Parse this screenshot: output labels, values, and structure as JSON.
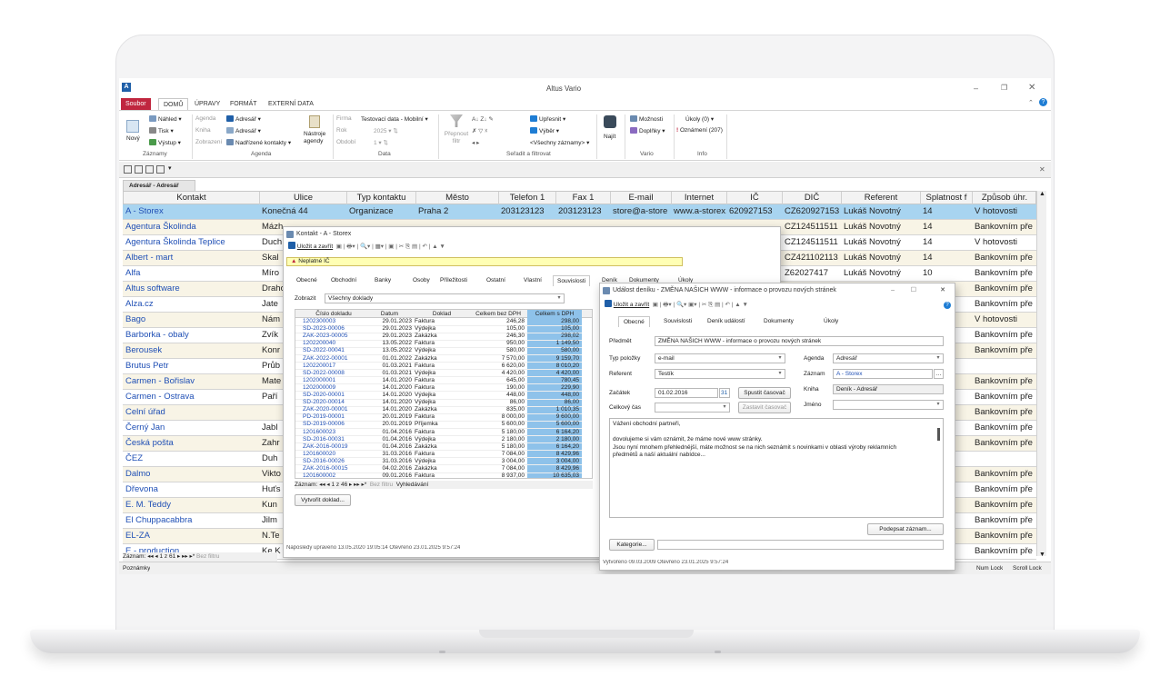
{
  "app": {
    "logo_letter": "A",
    "title": "Altus Vario",
    "colors": {
      "accent": "#c0263f",
      "selection": "#a8d4f0",
      "link": "#1f4fb5",
      "odd_row": "#f8f4e6",
      "sum_column": "#74b4e4"
    }
  },
  "ribbon_tabs": [
    "Soubor",
    "DOMŮ",
    "ÚPRAVY",
    "FORMÁT",
    "EXTERNÍ DATA"
  ],
  "ribbon": {
    "zaznamy": {
      "novy": "Nový",
      "nahled": "Náhled",
      "tisk": "Tisk",
      "vystup": "Výstup",
      "label": "Záznamy"
    },
    "agenda": {
      "agenda": "Agenda",
      "kniha": "Kniha",
      "zobrazeni": "Zobrazení",
      "adresar1": "Adresář",
      "adresar2": "Adresář",
      "nadrizene": "Nadřízené kontakty",
      "nastroje": "Nástroje agendy",
      "label": "Agenda"
    },
    "data": {
      "firma_label": "Firma",
      "firma_value": "Testovací data - Mobilní",
      "rok_label": "Rok",
      "rok_value": "2025",
      "obdobi_label": "Období",
      "obdobi_value": "1",
      "label": "Data"
    },
    "filtr": {
      "prepnout": "Přepnout filtr",
      "upresnit": "Upřesnit",
      "vyber": "Výběr",
      "vsechny": "<Všechny záznamy>",
      "label": "Seřadit a filtrovat"
    },
    "najit": {
      "label": "Najít"
    },
    "vario": {
      "moznosti": "Možnosti",
      "doplnky": "Doplňky",
      "label": "Vario"
    },
    "info": {
      "ukoly": "Úkoly (0)",
      "oznameni": "Oznámení (207)",
      "label": "Info"
    }
  },
  "document_tab": "Adresář - Adresář",
  "columns": [
    "Kontakt",
    "Ulice",
    "Typ kontaktu",
    "Město",
    "Telefon 1",
    "Fax 1",
    "E-mail",
    "Internet",
    "IČ",
    "DIČ",
    "Referent",
    "Splatnost f",
    "Způsob úhr."
  ],
  "rows": [
    [
      "A - Storex",
      "Konečná 44",
      "Organizace",
      "Praha 2",
      "203123123",
      "203123123",
      "store@a-store",
      "www.a-storex.",
      "620927153",
      "CZ620927153",
      "Lukáš Novotný",
      "14",
      "V hotovosti"
    ],
    [
      "Agentura Školinda",
      "Mázh",
      "",
      "",
      "",
      "",
      "",
      "",
      "",
      "CZ124511511",
      "Lukáš Novotný",
      "14",
      "Bankovním pře"
    ],
    [
      "Agentura Školinda Teplice",
      "Duch",
      "",
      "",
      "",
      "",
      "",
      "",
      "",
      "CZ124511511",
      "Lukáš Novotný",
      "14",
      "V hotovosti"
    ],
    [
      "Albert - mart",
      "Skal",
      "",
      "",
      "",
      "",
      "",
      "",
      "",
      "CZ421102113",
      "Lukáš Novotný",
      "14",
      "Bankovním pře"
    ],
    [
      "Alfa",
      "Míro",
      "",
      "",
      "",
      "",
      "",
      "",
      "",
      "Z62027417",
      "Lukáš Novotný",
      "10",
      "Bankovním pře"
    ],
    [
      "Altus software",
      "Draho",
      "",
      "",
      "",
      "",
      "",
      "",
      "",
      "",
      "",
      "",
      "Bankovním pře"
    ],
    [
      "Alza.cz",
      "Jate",
      "",
      "",
      "",
      "",
      "",
      "",
      "",
      "",
      "",
      "",
      "Bankovním pře"
    ],
    [
      "Bago",
      "Nám",
      "",
      "",
      "",
      "",
      "",
      "",
      "",
      "",
      "",
      "",
      "V hotovosti"
    ],
    [
      "Barborka - obaly",
      "Zvík",
      "",
      "",
      "",
      "",
      "",
      "",
      "",
      "",
      "",
      "",
      "Bankovním pře"
    ],
    [
      "Berousek",
      "Konr",
      "",
      "",
      "",
      "",
      "",
      "",
      "",
      "",
      "",
      "",
      "Bankovním pře"
    ],
    [
      "Brutus Petr",
      "Průb",
      "",
      "",
      "",
      "",
      "",
      "",
      "",
      "",
      "",
      "",
      ""
    ],
    [
      "Carmen - Bořislav",
      "Mate",
      "",
      "",
      "",
      "",
      "",
      "",
      "",
      "",
      "",
      "",
      "Bankovním pře"
    ],
    [
      "Carmen - Ostrava",
      "Paří",
      "",
      "",
      "",
      "",
      "",
      "",
      "",
      "",
      "",
      "",
      "Bankovním pře"
    ],
    [
      "Celní úřad",
      "",
      "",
      "",
      "",
      "",
      "",
      "",
      "",
      "",
      "",
      "",
      "Bankovním pře"
    ],
    [
      "Černý Jan",
      "Jabl",
      "",
      "",
      "",
      "",
      "",
      "",
      "",
      "",
      "",
      "",
      "Bankovním pře"
    ],
    [
      "Česká pošta",
      "Zahr",
      "",
      "",
      "",
      "",
      "",
      "",
      "",
      "",
      "",
      "",
      "Bankovním pře"
    ],
    [
      "ČEZ",
      "Duh",
      "",
      "",
      "",
      "",
      "",
      "",
      "",
      "",
      "",
      "",
      ""
    ],
    [
      "Dalmo",
      "Vikto",
      "",
      "",
      "",
      "",
      "",
      "",
      "",
      "",
      "",
      "",
      "Bankovním pře"
    ],
    [
      "Dřevona",
      "Huťs",
      "",
      "",
      "",
      "",
      "",
      "",
      "",
      "",
      "",
      "",
      "Bankovním pře"
    ],
    [
      "E. M. Teddy",
      "Kun",
      "",
      "",
      "",
      "",
      "",
      "",
      "",
      "",
      "",
      "",
      "Bankovním pře"
    ],
    [
      "El Chuppacabbra",
      "Jilm",
      "",
      "",
      "",
      "",
      "",
      "",
      "",
      "",
      "",
      "",
      "Bankovním pře"
    ],
    [
      "EL-ZA",
      "N.Te",
      "",
      "",
      "",
      "",
      "",
      "",
      "",
      "",
      "",
      "",
      "Bankovním pře"
    ],
    [
      "E - production",
      "Ke K",
      "",
      "",
      "",
      "",
      "",
      "",
      "",
      "",
      "",
      "",
      "Bankovním pře"
    ]
  ],
  "status": {
    "record_nav": "Záznam:",
    "record_pos": "1 z 61",
    "no_filter": "Bez filtru",
    "search": "Vyhledávání",
    "notes": "Poznámky",
    "num_lock": "Num Lock",
    "scroll_lock": "Scroll Lock"
  },
  "kontakt_win": {
    "title": "Kontakt - A - Storex",
    "save": "Uložit a zavřít",
    "warning": "Neplatné IČ",
    "tabs": [
      "Obecné",
      "Obchodní",
      "Banky",
      "Osoby",
      "Příležitosti",
      "Ostatní",
      "Vlastní",
      "Souvislosti",
      "Deník",
      "Dokumenty",
      "Úkoly"
    ],
    "zobrazit_label": "Zobrazit",
    "zobrazit_value": "Všechny doklady",
    "sub_columns": [
      "Číslo dokladu",
      "Datum",
      "Doklad",
      "Celkem bez DPH",
      "Celkem s DPH"
    ],
    "sub_rows": [
      [
        "1202300003",
        "29.01.2023",
        "Faktura",
        "246,28",
        "298,00"
      ],
      [
        "SD-2023-00006",
        "29.01.2023",
        "Výdejka",
        "105,00",
        "105,00"
      ],
      [
        "ZAK-2023-00005",
        "29.01.2023",
        "Zakázka",
        "246,30",
        "298,02"
      ],
      [
        "1202200040",
        "13.05.2022",
        "Faktura",
        "950,00",
        "1 149,50"
      ],
      [
        "SD-2022-00041",
        "13.05.2022",
        "Výdejka",
        "580,00",
        "580,00"
      ],
      [
        "ZAK-2022-00001",
        "01.01.2022",
        "Zakázka",
        "7 570,00",
        "9 159,70"
      ],
      [
        "1202200017",
        "01.03.2021",
        "Faktura",
        "6 620,00",
        "8 010,20"
      ],
      [
        "SD-2022-00008",
        "01.03.2021",
        "Výdejka",
        "4 420,00",
        "4 420,00"
      ],
      [
        "1202000001",
        "14.01.2020",
        "Faktura",
        "645,00",
        "780,45"
      ],
      [
        "1202000009",
        "14.01.2020",
        "Faktura",
        "190,00",
        "229,90"
      ],
      [
        "SD-2020-00001",
        "14.01.2020",
        "Výdejka",
        "448,00",
        "448,00"
      ],
      [
        "SD-2020-00014",
        "14.01.2020",
        "Výdejka",
        "86,00",
        "86,00"
      ],
      [
        "ZAK-2020-00001",
        "14.01.2020",
        "Zakázka",
        "835,00",
        "1 010,35"
      ],
      [
        "PD-2019-00001",
        "20.01.2019",
        "Faktura",
        "8 000,00",
        "9 600,00"
      ],
      [
        "SD-2019-00006",
        "20.01.2019",
        "Příjemka",
        "5 600,00",
        "5 600,00"
      ],
      [
        "1201600023",
        "01.04.2016",
        "Faktura",
        "5 180,00",
        "6 164,20"
      ],
      [
        "SD-2016-00031",
        "01.04.2016",
        "Výdejka",
        "2 180,00",
        "2 180,00"
      ],
      [
        "ZAK-2016-00019",
        "01.04.2016",
        "Zakázka",
        "5 180,00",
        "6 164,20"
      ],
      [
        "1201600020",
        "31.03.2016",
        "Faktura",
        "7 084,00",
        "8 429,96"
      ],
      [
        "SD-2016-00026",
        "31.03.2016",
        "Výdejka",
        "3 004,00",
        "3 004,00"
      ],
      [
        "ZAK-2016-00015",
        "04.02.2016",
        "Zakázka",
        "7 084,00",
        "8 429,96"
      ],
      [
        "1201600002",
        "09.01.2016",
        "Faktura",
        "8 937,00",
        "10 635,03"
      ]
    ],
    "sub_nav": "Záznam:",
    "sub_pos": "1 z 46",
    "sub_nofilter": "Bez filtru",
    "sub_search": "Vyhledávání",
    "create_btn": "Vytvořit doklad...",
    "footer": "Naposledy upraveno 13.05.2020 19:05:14 Otevřeno 23.01.2025 9:57:24"
  },
  "udalost_win": {
    "title": "Událost deníku - ZMĚNA NAŠICH WWW - informace o provozu nových stránek",
    "save": "Uložit a zavřít",
    "tabs": [
      "Obecné",
      "Souvislosti",
      "Deník událostí",
      "Dokumenty",
      "Úkoly"
    ],
    "predmet_label": "Předmět",
    "predmet_value": "ZMĚNA NAŠICH WWW - informace o provozu nových stránek",
    "typ_label": "Typ položky",
    "typ_value": "e-mail",
    "referent_label": "Referent",
    "referent_value": "Testík",
    "zacatek_label": "Začátek",
    "zacatek_value": "01.02.2016",
    "calendar_day": "31",
    "celkovy_label": "Celkový čas",
    "spustit": "Spustit časovač",
    "zastavit": "Zastavit časovač",
    "agenda_label": "Agenda",
    "agenda_value": "Adresář",
    "zaznam_label": "Záznam",
    "zaznam_value": "A - Storex",
    "kniha_label": "Kniha",
    "kniha_value": "Deník - Adresář",
    "jmeno_label": "Jméno",
    "body_lines": [
      "Vážení obchodní partneři,",
      "",
      "dovolujeme si vám oznámit, že máme nové www stránky.",
      "Jsou nyní mnohem přehlednější, máte možnost se na nich seznámit s novinkami v oblasti výroby reklamních",
      "předmětů a naší aktuální nabídce..."
    ],
    "podepsat": "Podepsat záznam...",
    "kategorie": "Kategorie...",
    "footer": "Vytvořeno 09.03.2009 Otevřeno 23.01.2025 9:57:24"
  }
}
